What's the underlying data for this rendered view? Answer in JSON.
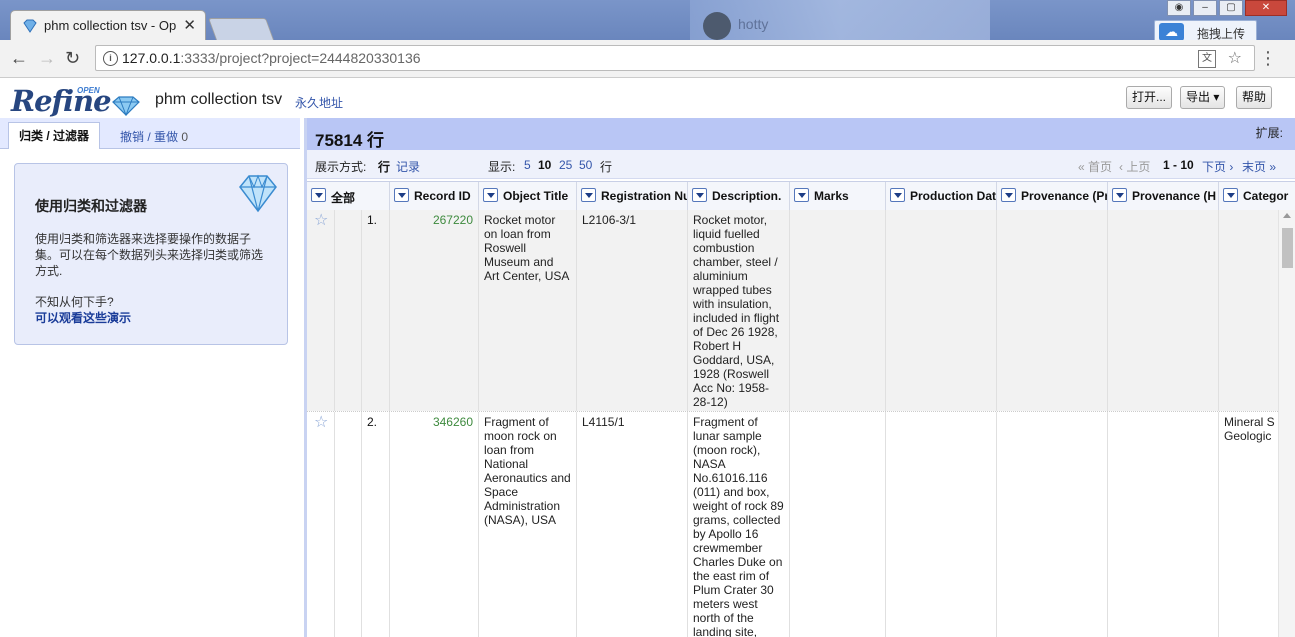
{
  "browser": {
    "tab_title": "phm collection tsv - Op",
    "url_host": "127.0.0.1",
    "url_rest": ":3333/project?project=2444820330136",
    "upload_label": "拖拽上传",
    "blurred_label": "hotty"
  },
  "header": {
    "logo_text": "Refine",
    "logo_open": "OPEN",
    "project_name": "phm collection tsv",
    "permalink": "永久地址",
    "open_label": "打开...",
    "export_label": "导出 ▾",
    "help_label": "帮助"
  },
  "left": {
    "tab_facets": "归类 / 过滤器",
    "tab_undo": "撤销 / 重做",
    "undo_count": "0",
    "intro_title": "使用归类和过滤器",
    "intro_body": "使用归类和筛选器来选择要操作的数据子集。可以在每个数据列头来选择归类或筛选方式.",
    "intro_q": "不知从何下手?",
    "intro_link": "可以观看这些演示"
  },
  "summary": {
    "row_count": "75814 行",
    "extensions": "扩展:"
  },
  "view": {
    "show_as": "展示方式:",
    "rows": "行",
    "records": "记录",
    "show": "显示:",
    "sizes": [
      "5",
      "10",
      "25",
      "50"
    ],
    "rows_unit": "行",
    "first": "« 首页",
    "prev": "‹ 上页",
    "range": "1 - 10",
    "next": "下页 ›",
    "last": "末页 »"
  },
  "columns": [
    "全部",
    "Record ID",
    "Object Title",
    "Registration Nu",
    "Description.",
    "Marks",
    "Production Dat",
    "Provenance (Pr",
    "Provenance (H",
    "Categor"
  ],
  "rows": [
    {
      "index": "1.",
      "record_id": "267220",
      "object_title": "Rocket motor on loan from Roswell Museum and Art Center, USA",
      "registration": "L2106-3/1",
      "description": "Rocket motor, liquid fuelled combustion chamber, steel / aluminium wrapped tubes with insulation, included in flight of Dec 26 1928, Robert H Goddard, USA, 1928 (Roswell Acc No: 1958-28-12)",
      "marks": "",
      "production_date": "",
      "provenance_p": "",
      "provenance_h": "",
      "category": ""
    },
    {
      "index": "2.",
      "record_id": "346260",
      "object_title": "Fragment of moon rock on loan from National Aeronautics and Space Administration (NASA), USA",
      "registration": "L4115/1",
      "description": "Fragment of lunar sample (moon rock), NASA No.61016.116 (011) and box, weight of rock 89 grams, collected by Apollo 16 crewmember Charles Duke on the east rim of Plum Crater 30 meters west north of the landing site,",
      "marks": "",
      "production_date": "",
      "provenance_p": "",
      "provenance_h": "",
      "category": "Mineral S\nGeologic"
    }
  ]
}
